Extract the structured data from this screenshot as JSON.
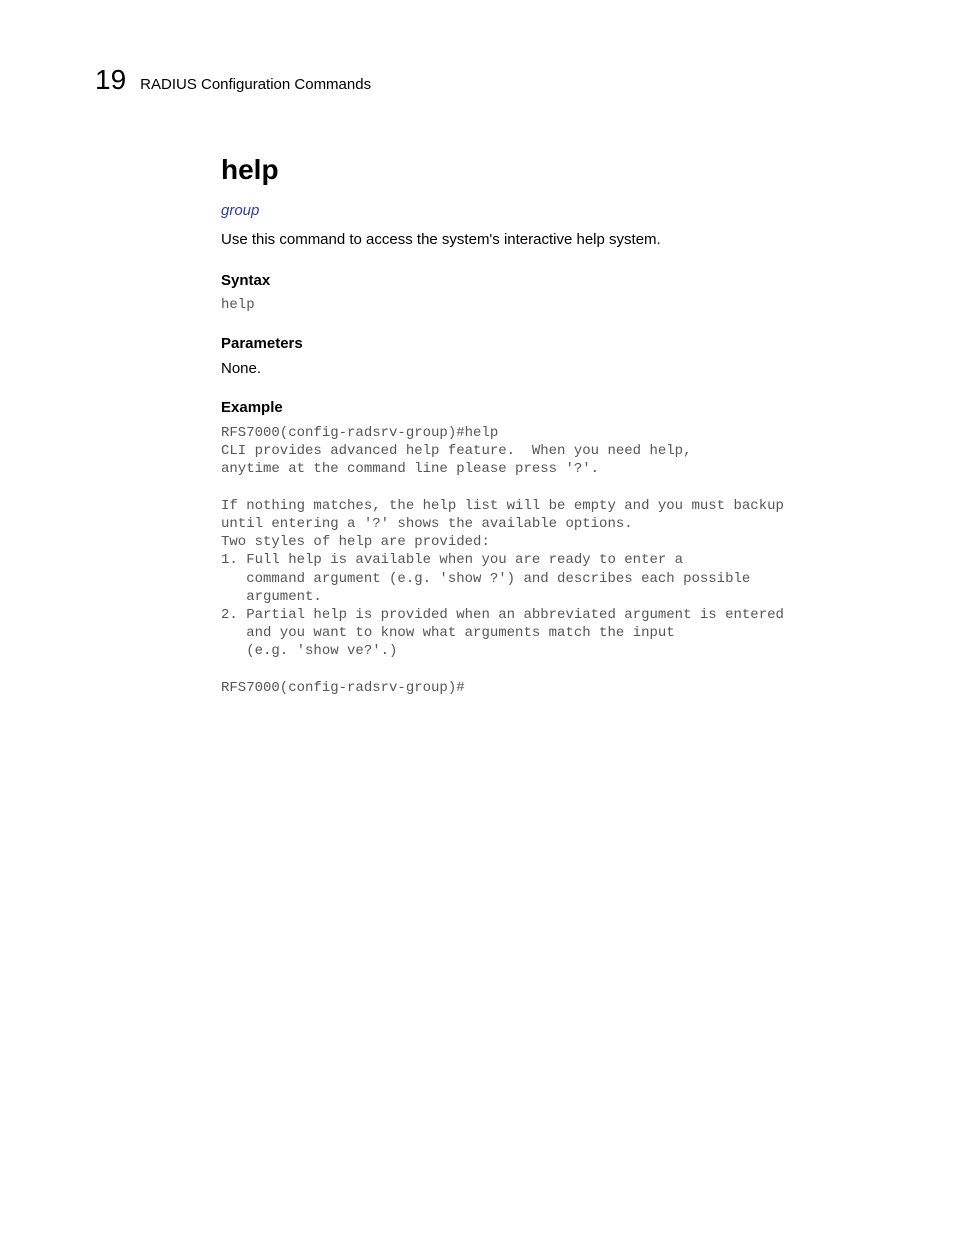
{
  "header": {
    "chapter_number": "19",
    "chapter_title": "RADIUS Configuration Commands"
  },
  "content": {
    "main_heading": "help",
    "link": "group",
    "description": "Use this command to access the system's interactive help system.",
    "syntax": {
      "heading": "Syntax",
      "code": "help"
    },
    "parameters": {
      "heading": "Parameters",
      "value": "None."
    },
    "example": {
      "heading": "Example",
      "code": "RFS7000(config-radsrv-group)#help\nCLI provides advanced help feature.  When you need help,\nanytime at the command line please press '?'.\n\nIf nothing matches, the help list will be empty and you must backup\nuntil entering a '?' shows the available options.\nTwo styles of help are provided:\n1. Full help is available when you are ready to enter a\n   command argument (e.g. 'show ?') and describes each possible\n   argument.\n2. Partial help is provided when an abbreviated argument is entered\n   and you want to know what arguments match the input\n   (e.g. 'show ve?'.)\n\nRFS7000(config-radsrv-group)#"
    }
  }
}
